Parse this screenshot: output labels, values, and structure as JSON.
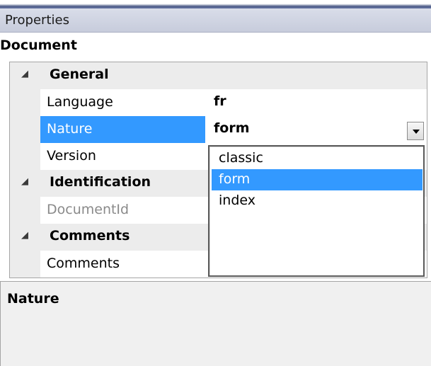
{
  "panel": {
    "title": "Properties",
    "object_name": "Document"
  },
  "grid": {
    "categories": [
      {
        "label": "General",
        "expanded": true,
        "properties": [
          {
            "name": "Language",
            "value": "fr"
          },
          {
            "name": "Nature",
            "value": "form",
            "selected": true
          },
          {
            "name": "Version",
            "value": ""
          }
        ]
      },
      {
        "label": "Identification",
        "expanded": true,
        "properties": [
          {
            "name": "DocumentId",
            "value": "",
            "disabled": true
          }
        ]
      },
      {
        "label": "Comments",
        "expanded": true,
        "properties": [
          {
            "name": "Comments",
            "value": ""
          }
        ]
      }
    ],
    "expand_icon": "collapse-triangle-icon",
    "dropdown_icon": "chevron-down-icon"
  },
  "dropdown": {
    "options": [
      "classic",
      "form",
      "index"
    ],
    "selected": "form"
  },
  "description": {
    "title": "Nature"
  },
  "colors": {
    "selection": "#3399ff",
    "title_bar": "#c7ccdc",
    "category_background": "#ececec"
  }
}
